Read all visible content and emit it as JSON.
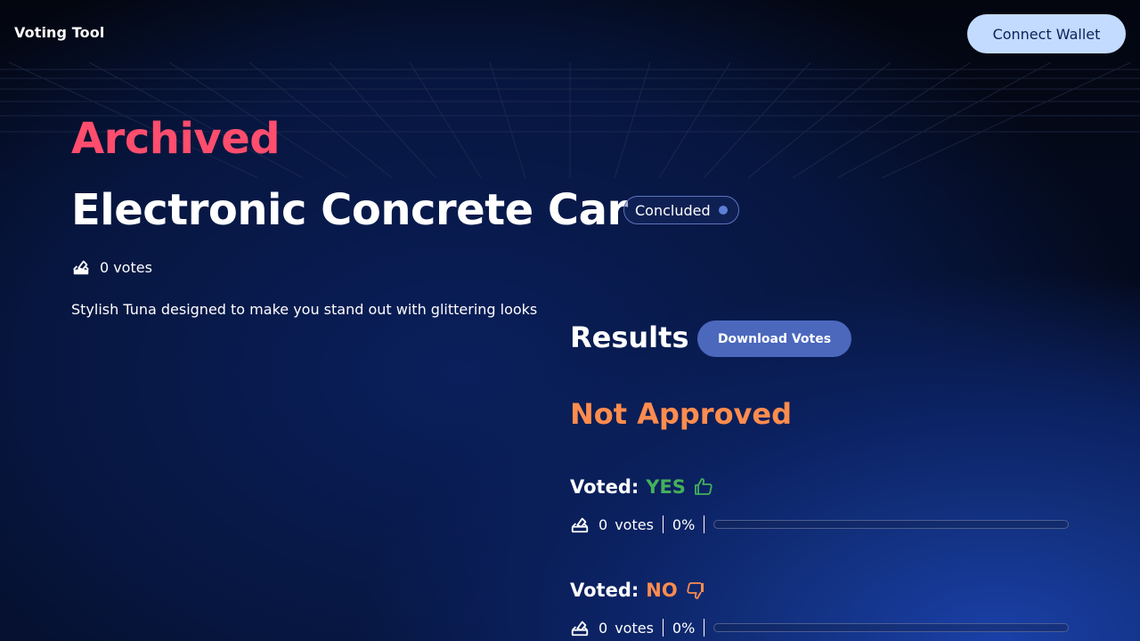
{
  "header": {
    "app_title": "Voting Tool",
    "connect_wallet_label": "Connect Wallet"
  },
  "proposal": {
    "archive_label": "Archived",
    "title": "Electronic Concrete Car",
    "status": "Concluded",
    "vote_count": "0",
    "vote_word": "votes",
    "description": "Stylish Tuna designed to make you stand out with glittering looks"
  },
  "results": {
    "title": "Results",
    "download_label": "Download Votes",
    "outcome": "Not Approved",
    "options": [
      {
        "voted_label": "Voted:",
        "choice": "YES",
        "icon": "thumbs-up-icon",
        "votes": "0",
        "votes_word": "votes",
        "percent_label": "0%",
        "percent": 0,
        "color": "#43b05c"
      },
      {
        "voted_label": "Voted:",
        "choice": "NO",
        "icon": "thumbs-down-icon",
        "votes": "0",
        "votes_word": "votes",
        "percent_label": "0%",
        "percent": 0,
        "color": "#ff8c4d"
      }
    ]
  },
  "colors": {
    "archived": "#ff4d6d",
    "not_approved": "#ff8c4d",
    "connect_button": "#c3dbff",
    "download_button": "#4b68bd"
  }
}
